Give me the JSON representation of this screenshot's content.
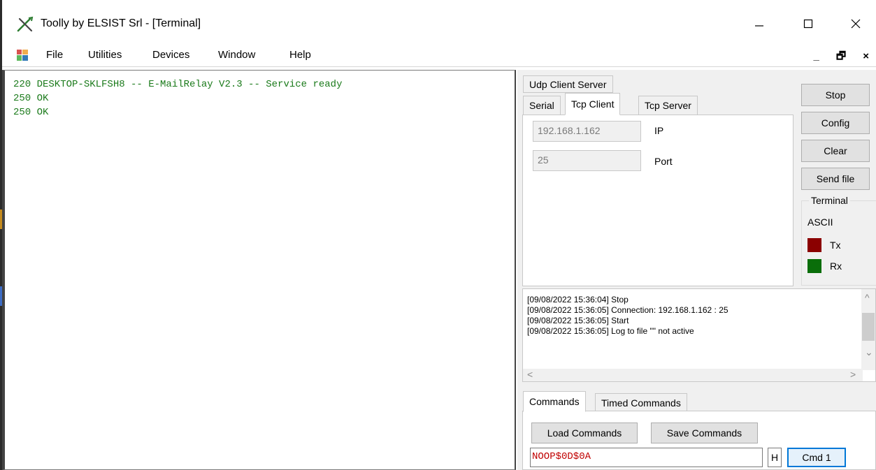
{
  "window": {
    "title": "Toolly by ELSIST Srl - [Terminal]",
    "icon": "tools-icon"
  },
  "menu": {
    "items": [
      "File",
      "Utilities",
      "Devices",
      "Window",
      "Help"
    ],
    "mdi_controls": "_ Ɉ x"
  },
  "terminal": {
    "lines": [
      "220 DESKTOP-SKLFSH8 -- E-MailRelay V2.3 -- Service ready",
      "250 OK",
      "250 OK"
    ],
    "text_color": "#1a7a1a"
  },
  "conn_tabs": {
    "udp": "Udp Client Server",
    "serial": "Serial",
    "tcp_client": "Tcp Client",
    "tcp_server": "Tcp Server"
  },
  "tcp_client": {
    "ip_value": "192.168.1.162",
    "ip_label": "IP",
    "port_value": "25",
    "port_label": "Port"
  },
  "side_buttons": {
    "stop": "Stop",
    "config": "Config",
    "clear": "Clear",
    "send_file": "Send file"
  },
  "terminal_group": {
    "title": "Terminal",
    "mode": "ASCII",
    "tx_label": "Tx",
    "rx_label": "Rx",
    "tx_color": "#8b0000",
    "rx_color": "#0a6e0a"
  },
  "log": {
    "lines": [
      "[09/08/2022 15:36:04] Stop",
      "[09/08/2022 15:36:05] Connection: 192.168.1.162 : 25",
      "[09/08/2022 15:36:05] Start",
      "[09/08/2022 15:36:05] Log to file \"\" not active"
    ]
  },
  "cmd_tabs": {
    "commands": "Commands",
    "timed": "Timed Commands"
  },
  "commands": {
    "load": "Load Commands",
    "save": "Save Commands",
    "input_value": "NOOP$0D$0A",
    "h_label": "H",
    "cmd_button": "Cmd 1"
  }
}
